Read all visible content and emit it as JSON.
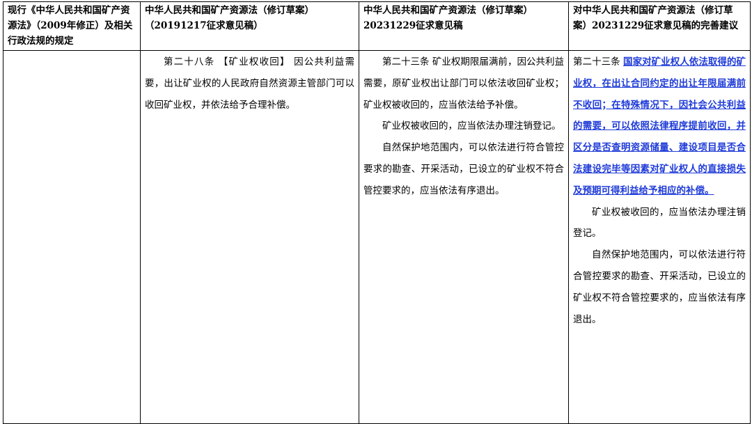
{
  "headers": [
    "现行《中华人民共和国矿产资源法》（2009年修正）及相关行政法规的规定",
    "中华人民共和国矿产资源法（修订草案）（20191217征求意见稿）",
    "中华人民共和国矿产资源法（修订草案）20231229征求意见稿",
    "对中华人民共和国矿产资源法（修订草案）20231229征求意见稿的完善建议"
  ],
  "col1": {
    "text": ""
  },
  "col2": {
    "p1": "第二十八条 【矿业权收回】 因公共利益需要，出让矿业权的人民政府自然资源主管部门可以收回矿业权，并依法给予合理补偿。"
  },
  "col3": {
    "p1": "第二十三条 矿业权期限届满前，因公共利益需要，原矿业权出让部门可以依法收回矿业权；矿业权被收回的，应当依法给予补偿。",
    "p2": "矿业权被收回的，应当依法办理注销登记。",
    "p3": "自然保护地范围内，可以依法进行符合管控要求的勘查、开采活动，已设立的矿业权不符合管控要求的，应当依法有序退出。"
  },
  "col4": {
    "p1_prefix": "第二十三条 ",
    "p1_amended": "国家对矿业权人依法取得的矿业权，在出让合同约定的出让年限届满前不收回；在特殊情况下，因社会公共利益的需要，可以依照法律程序提前收回，并区分是否查明资源储量、建设项目是否合法建设完毕等因素对矿业权人的直接损失及预期可得利益给予相应的补偿。",
    "p2": "矿业权被收回的，应当依法办理注销登记。",
    "p3": "自然保护地范围内，可以依法进行符合管控要求的勘查、开采活动，已设立的矿业权不符合管控要求的，应当依法有序退出。"
  },
  "colors": {
    "amend_text": "#1f3bd8",
    "border": "#000000"
  }
}
